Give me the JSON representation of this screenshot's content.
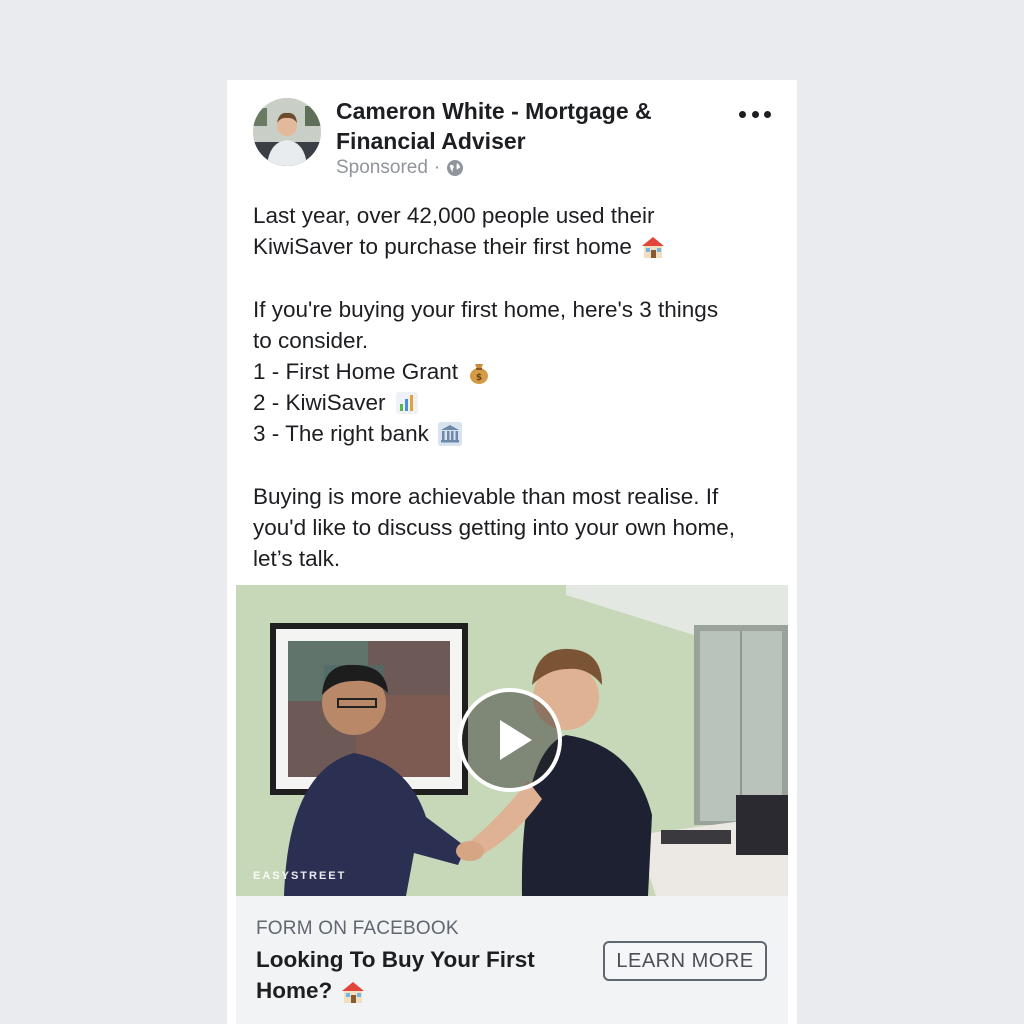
{
  "post": {
    "page_name": "Cameron White - Mortgage & Financial Adviser",
    "sponsored_label": "Sponsored",
    "separator": "·",
    "audience_icon": "globe-icon",
    "more_icon": "more-options-icon",
    "text_lines": [
      "Last year, over 42,000 people used their",
      "KiwiSaver to purchase their first home",
      "If you're buying your first home, here's 3 things",
      "to consider.",
      "1 - First Home Grant",
      "2 - KiwiSaver",
      "3 - The right bank",
      "Buying is more achievable than most realise. If",
      "you'd like to discuss getting into your own home,",
      "let’s talk."
    ],
    "emojis": {
      "house": "house-emoji",
      "money_bag": "money-bag-emoji",
      "bar_chart": "bar-chart-emoji",
      "bank": "bank-emoji"
    }
  },
  "video": {
    "watermark": "EASYSTREET",
    "play_icon": "play-icon"
  },
  "cta": {
    "type_label": "FORM ON FACEBOOK",
    "headline": "Looking To Buy Your First Home?",
    "button_label": "LEARN MORE"
  },
  "colors": {
    "background": "#e9ebee",
    "card": "#ffffff",
    "text": "#1c1e21",
    "meta": "#90949c",
    "cta_bar": "#f2f3f5"
  }
}
